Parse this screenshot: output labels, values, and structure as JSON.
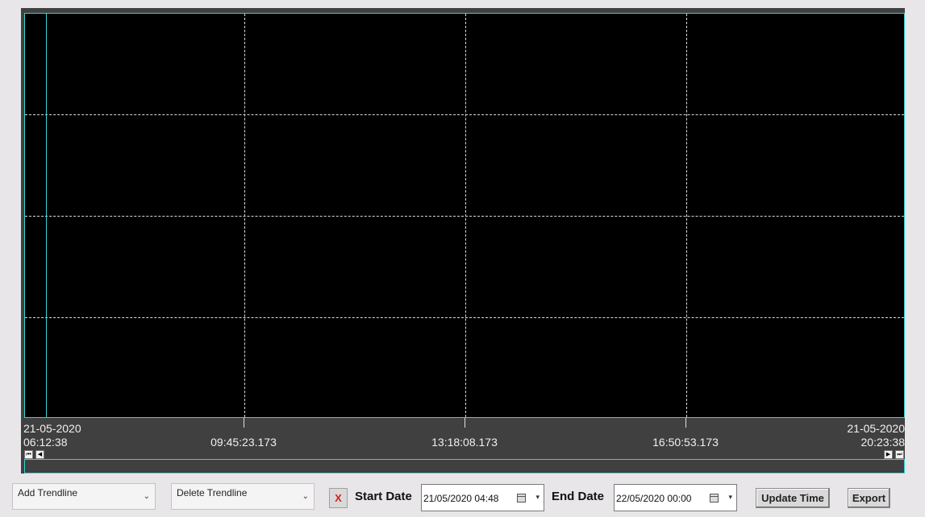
{
  "trend": {
    "start": {
      "date": "21-05-2020",
      "time": "06:12:38"
    },
    "end": {
      "date": "21-05-2020",
      "time": "20:23:38"
    },
    "ticks": [
      "09:45:23.173",
      "13:18:08.173",
      "16:50:53.173"
    ],
    "scroll": {
      "first": "⏮",
      "prev": "◀",
      "next": "▶",
      "last": "⏭"
    }
  },
  "controls": {
    "add_trendline": "Add Trendline",
    "delete_trendline": "Delete Trendline",
    "combo_chevron": "⌄",
    "clear_button": "X",
    "start_date_label": "Start Date",
    "start_date_value": "21/05/2020 04:48",
    "end_date_label": "End Date",
    "end_date_value": "22/05/2020 00:00",
    "date_caret": "▾",
    "update_time": "Update Time",
    "export": "Export"
  },
  "colors": {
    "accent": "#35d4d4",
    "plot_bg": "#000000",
    "frame": "#404040",
    "clear_icon": "#d41f1f"
  },
  "icons": {
    "calendar": "calendar-icon",
    "clear": "close-icon"
  }
}
